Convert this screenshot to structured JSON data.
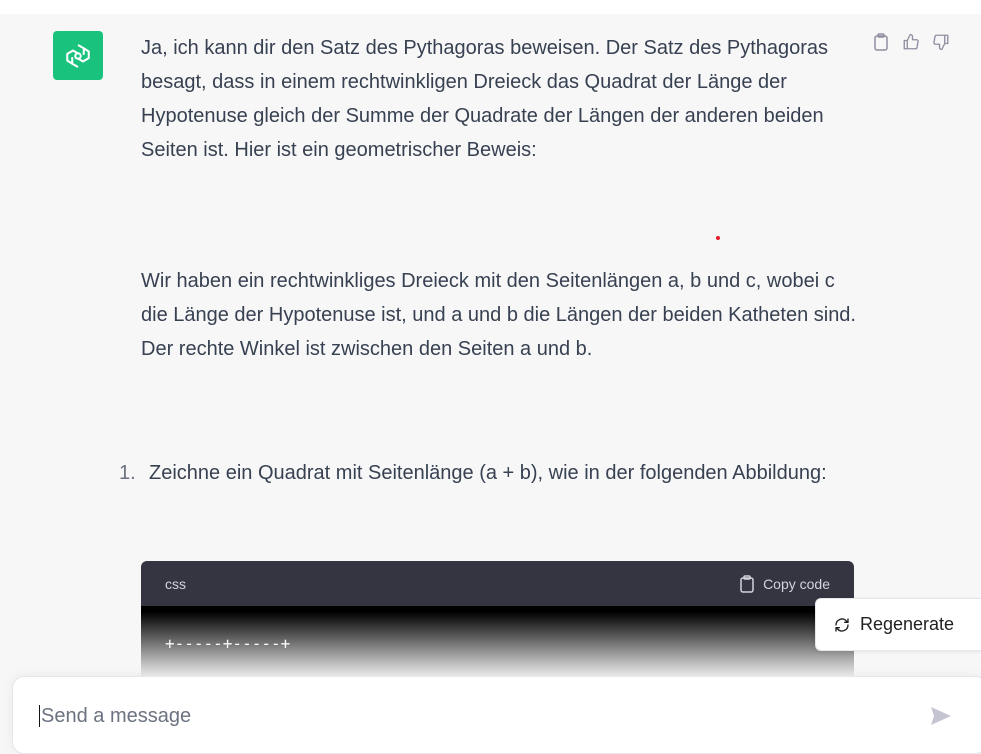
{
  "message": {
    "paragraph1": "Ja, ich kann dir den Satz des Pythagoras beweisen. Der Satz des Pythagoras besagt, dass in einem rechtwinkligen Dreieck das Quadrat der Länge der Hypotenuse gleich der Summe der Quadrate der Längen der anderen beiden Seiten ist. Hier ist ein geometrischer Beweis:",
    "paragraph2": "Wir haben ein rechtwinkliges Dreieck mit den Seitenlängen a, b und c, wobei c die Länge der Hypotenuse ist, und a und b die Längen der beiden Katheten sind. Der rechte Winkel ist zwischen den Seiten a und b.",
    "list": [
      {
        "number": "1.",
        "text": "Zeichne ein Quadrat mit Seitenlänge (a + b), wie in der folgenden Abbildung:"
      }
    ]
  },
  "code_block": {
    "language": "css",
    "copy_label": "Copy code",
    "line1": "+-----+-----+"
  },
  "regenerate_label": "Regenerate",
  "composer": {
    "placeholder": "Send a message"
  },
  "colors": {
    "avatar": "#19c37d",
    "code_header": "#343541"
  },
  "icons": [
    "openai-logo-icon",
    "clipboard-icon",
    "thumbs-up-icon",
    "thumbs-down-icon",
    "refresh-icon",
    "send-icon"
  ]
}
